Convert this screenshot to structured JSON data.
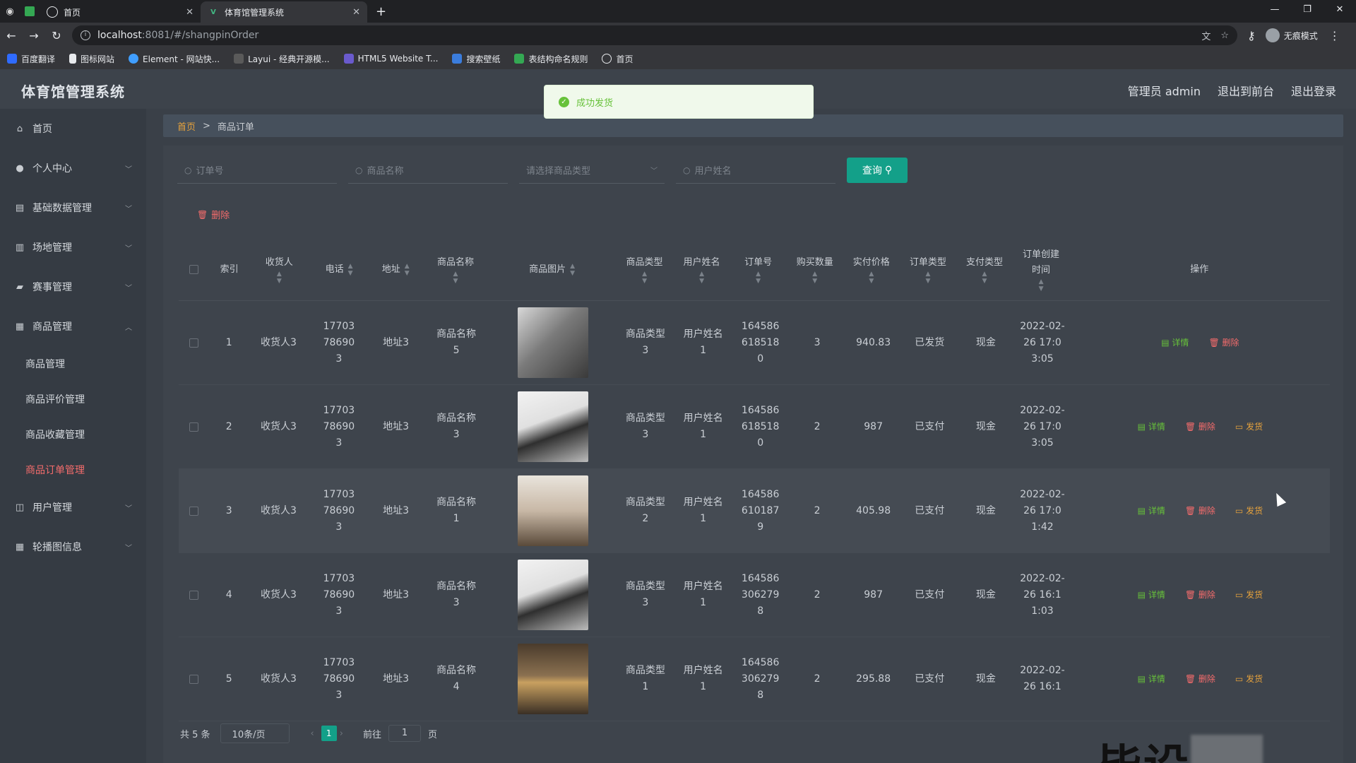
{
  "browser": {
    "tabs": [
      {
        "title": "首页",
        "active": false
      },
      {
        "title": "体育馆管理系统",
        "active": true
      }
    ],
    "url_host": "localhost",
    "url_path": ":8081/#/shangpinOrder",
    "profile_label": "无痕模式",
    "bookmarks": [
      "百度翻译",
      "图标网站",
      "Element - 网站快...",
      "Layui - 经典开源模...",
      "HTML5 Website T...",
      "搜索壁纸",
      "表结构命名规则",
      "首页"
    ]
  },
  "app": {
    "title": "体育馆管理系统",
    "header": {
      "admin": "管理员 admin",
      "front": "退出到前台",
      "logout": "退出登录"
    },
    "toast": "成功发货"
  },
  "sidebar": {
    "items": [
      {
        "label": "首页",
        "icon": "home-icon"
      },
      {
        "label": "个人中心",
        "icon": "user-icon"
      },
      {
        "label": "基础数据管理",
        "icon": "database-icon"
      },
      {
        "label": "场地管理",
        "icon": "chart-icon"
      },
      {
        "label": "赛事管理",
        "icon": "trophy-icon"
      },
      {
        "label": "商品管理",
        "icon": "goods-icon"
      }
    ],
    "sub_items": [
      "商品管理",
      "商品评价管理",
      "商品收藏管理",
      "商品订单管理"
    ],
    "bottom_items": [
      {
        "label": "用户管理",
        "icon": "users-icon"
      },
      {
        "label": "轮播图信息",
        "icon": "grid-icon"
      }
    ]
  },
  "breadcrumb": {
    "home": "首页",
    "sep": ">",
    "current": "商品订单"
  },
  "search": {
    "order_no": "订单号",
    "goods_name": "商品名称",
    "goods_type": "请选择商品类型",
    "user_name": "用户姓名",
    "query_label": "查询"
  },
  "actions": {
    "delete_label": "删除"
  },
  "table": {
    "headers": [
      "索引",
      "收货人",
      "电话",
      "地址",
      "商品名称",
      "商品图片",
      "商品类型",
      "用户姓名",
      "订单号",
      "购买数量",
      "实付价格",
      "订单类型",
      "支付类型",
      "订单创建时间",
      "操作"
    ],
    "op_labels": {
      "detail": "详情",
      "delete": "删除",
      "ship": "发货"
    },
    "rows": [
      {
        "index": "1",
        "receiver": "收货人3",
        "phone": "17703786903",
        "address": "地址3",
        "goods_name": "商品名称5",
        "goods_type": "商品类型3",
        "user_name": "用户姓名1",
        "order_no": "1645866185180",
        "qty": "3",
        "price": "940.83",
        "order_type": "已发货",
        "pay_type": "现金",
        "created": "2022-02-26 17:03:05",
        "ship": false,
        "img": "laptop-closed"
      },
      {
        "index": "2",
        "receiver": "收货人3",
        "phone": "17703786903",
        "address": "地址3",
        "goods_name": "商品名称3",
        "goods_type": "商品类型3",
        "user_name": "用户姓名1",
        "order_no": "1645866185180",
        "qty": "2",
        "price": "987",
        "order_type": "已支付",
        "pay_type": "现金",
        "created": "2022-02-26 17:03:05",
        "ship": true,
        "img": "laptop-open"
      },
      {
        "index": "3",
        "receiver": "收货人3",
        "phone": "17703786903",
        "address": "地址3",
        "goods_name": "商品名称1",
        "goods_type": "商品类型2",
        "user_name": "用户姓名1",
        "order_no": "1645866101879",
        "qty": "2",
        "price": "405.98",
        "order_type": "已支付",
        "pay_type": "现金",
        "created": "2022-02-26 17:01:42",
        "ship": true,
        "img": "cosmetics"
      },
      {
        "index": "4",
        "receiver": "收货人3",
        "phone": "17703786903",
        "address": "地址3",
        "goods_name": "商品名称3",
        "goods_type": "商品类型3",
        "user_name": "用户姓名1",
        "order_no": "1645863062798",
        "qty": "2",
        "price": "987",
        "order_type": "已支付",
        "pay_type": "现金",
        "created": "2022-02-26 16:11:03",
        "ship": true,
        "img": "laptop-open"
      },
      {
        "index": "5",
        "receiver": "收货人3",
        "phone": "17703786903",
        "address": "地址3",
        "goods_name": "商品名称4",
        "goods_type": "商品类型1",
        "user_name": "用户姓名1",
        "order_no": "1645863062798",
        "qty": "2",
        "price": "295.88",
        "order_type": "已支付",
        "pay_type": "现金",
        "created": "2022-02-26 16:1",
        "ship": true,
        "img": "bracelet"
      }
    ]
  },
  "pager": {
    "total": "共 5 条",
    "size": "10条/页",
    "page": "1",
    "goto_label": "前往",
    "goto_value": "1",
    "page_label": "页"
  },
  "watermark": "毕设"
}
